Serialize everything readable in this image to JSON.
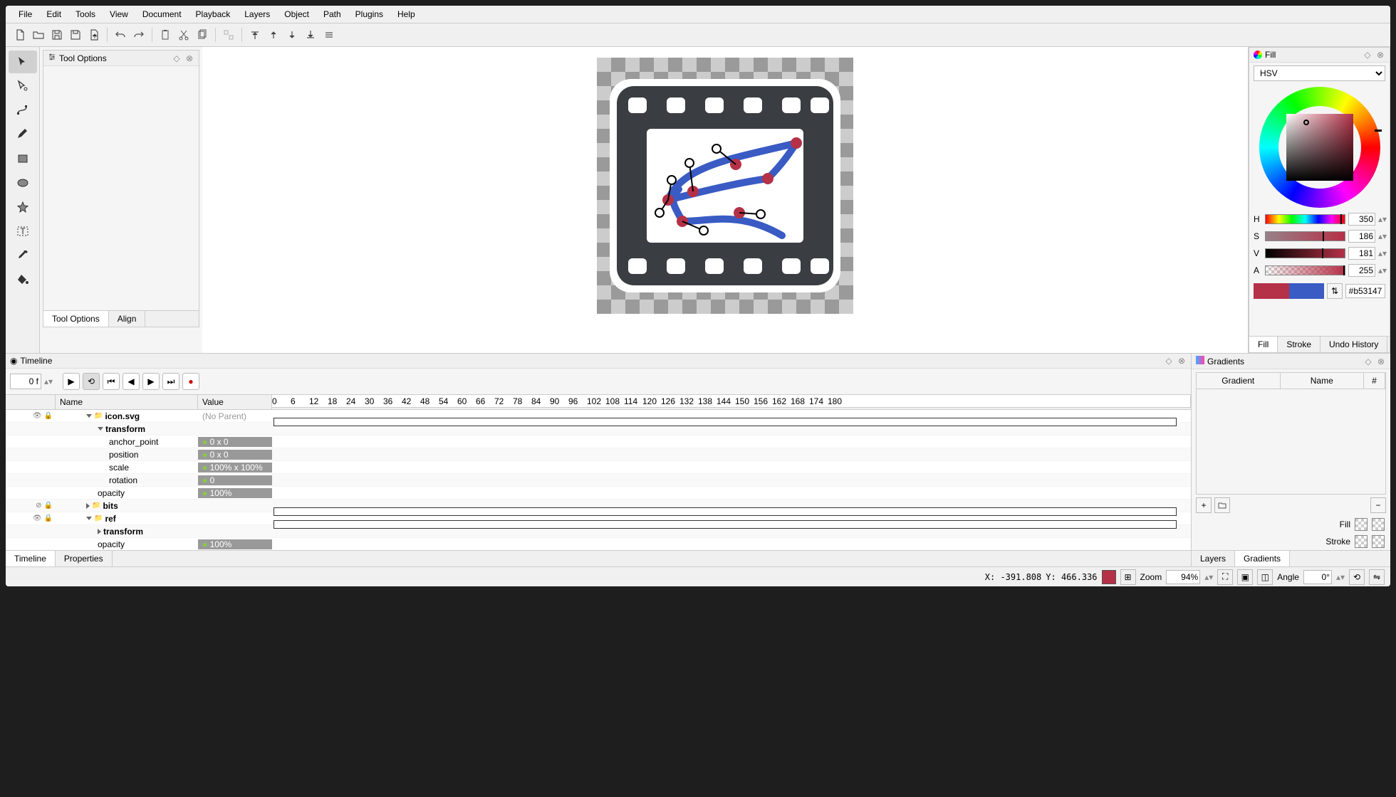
{
  "menu": [
    "File",
    "Edit",
    "Tools",
    "View",
    "Document",
    "Playback",
    "Layers",
    "Object",
    "Path",
    "Plugins",
    "Help"
  ],
  "toolOptions": {
    "title": "Tool Options",
    "tabs": [
      "Tool Options",
      "Align"
    ]
  },
  "fill": {
    "title": "Fill",
    "mode": "HSV",
    "H": {
      "label": "H",
      "value": "350"
    },
    "S": {
      "label": "S",
      "value": "186"
    },
    "V": {
      "label": "V",
      "value": "181"
    },
    "A": {
      "label": "A",
      "value": "255"
    },
    "hex": "#b53147",
    "primary": "#b53147",
    "secondary": "#3a5bc4",
    "tabs": [
      "Fill",
      "Stroke",
      "Undo History"
    ]
  },
  "timeline": {
    "title": "Timeline",
    "frame": "0 f",
    "headers": {
      "name": "Name",
      "value": "Value"
    },
    "ticks": [
      0,
      6,
      12,
      18,
      24,
      30,
      36,
      42,
      48,
      54,
      60,
      66,
      72,
      78,
      84,
      90,
      96,
      102,
      108,
      114,
      120,
      126,
      132,
      138,
      144,
      150,
      156,
      162,
      168,
      174,
      180
    ],
    "rows": [
      {
        "icons": [
          "eye",
          "lock"
        ],
        "indent": 0,
        "chev": "down",
        "type": "folder",
        "name": "icon.svg",
        "value": "(No Parent)",
        "valStyle": "muted",
        "track": true
      },
      {
        "indent": 1,
        "chev": "down",
        "name": "transform"
      },
      {
        "indent": 2,
        "name": "anchor_point",
        "value": "0 x 0",
        "fill": true,
        "dot": true
      },
      {
        "indent": 2,
        "name": "position",
        "value": "0 x 0",
        "fill": true,
        "dot": true
      },
      {
        "indent": 2,
        "name": "scale",
        "value": "100% x 100%",
        "fill": true,
        "dot": true
      },
      {
        "indent": 2,
        "name": "rotation",
        "value": "0",
        "fill": true,
        "dot": true
      },
      {
        "indent": 1,
        "name": "opacity",
        "value": "100%",
        "fill": true,
        "dot": true
      },
      {
        "icons": [
          "noeye",
          "lock"
        ],
        "indent": 0,
        "chev": "right",
        "type": "folder",
        "name": "bits",
        "track": true
      },
      {
        "icons": [
          "eye",
          "lock"
        ],
        "indent": 0,
        "chev": "down",
        "type": "folder",
        "name": "ref",
        "track": true
      },
      {
        "indent": 1,
        "chev": "right",
        "name": "transform"
      },
      {
        "indent": 1,
        "name": "opacity",
        "value": "100%",
        "fill": true,
        "dot": true
      }
    ],
    "bottomTabs": [
      "Timeline",
      "Properties"
    ]
  },
  "gradients": {
    "title": "Gradients",
    "headers": [
      "Gradient",
      "Name",
      "#"
    ],
    "fillLabel": "Fill",
    "strokeLabel": "Stroke",
    "bottomTabs": [
      "Layers",
      "Gradients"
    ]
  },
  "status": {
    "x": "X: -391.808",
    "y": "Y: 466.336",
    "zoomLabel": "Zoom",
    "zoom": "94%",
    "angleLabel": "Angle",
    "angle": "0°",
    "color": "#b53147"
  }
}
